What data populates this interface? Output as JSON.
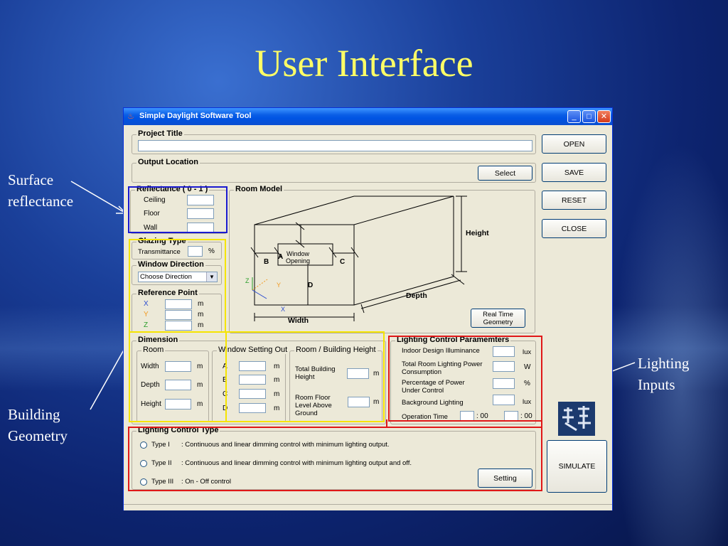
{
  "slide": {
    "title": "User Interface"
  },
  "annotations": {
    "surface": [
      "Surface",
      "reflectance"
    ],
    "building": [
      "Building",
      "Geometry"
    ],
    "lighting": [
      "Lighting",
      "Inputs"
    ]
  },
  "window": {
    "title": "Simple Daylight Software Tool",
    "icon": "app-icon"
  },
  "project": {
    "label": "Project Title",
    "value": ""
  },
  "output": {
    "label": "Output Location",
    "select_label": "Select"
  },
  "side_buttons": {
    "open": "OPEN",
    "save": "SAVE",
    "reset": "RESET",
    "close": "CLOSE",
    "simulate": "SIMULATE"
  },
  "reflectance": {
    "label": "Reflectance ( 0 - 1 )",
    "ceiling": "Ceiling",
    "floor": "Floor",
    "wall": "Wall"
  },
  "room_model": {
    "label": "Room Model",
    "a": "A",
    "b": "B",
    "c": "C",
    "d": "D",
    "window": [
      "Window",
      "Opening"
    ],
    "height": "Height",
    "depth": "Depth",
    "width": "Width",
    "axis_x": "X",
    "axis_y": "Y",
    "axis_z": "Z",
    "realtime": [
      "Real Time",
      "Geometry"
    ]
  },
  "glazing": {
    "label": "Glazing Type",
    "transmittance": "Transmittance",
    "unit": "%"
  },
  "window_direction": {
    "label": "Window Direction",
    "selected": "Choose Direction"
  },
  "reference_point": {
    "label": "Reference Point",
    "x": "X",
    "y": "Y",
    "z": "Z",
    "unit": "m"
  },
  "dimension": {
    "label": "Dimension",
    "room": {
      "label": "Room",
      "width": "Width",
      "depth": "Depth",
      "height": "Height",
      "unit": "m"
    },
    "window_setting": {
      "label": "Window Setting Out",
      "a": "A",
      "b": "B",
      "c": "C",
      "d": "D",
      "unit": "m"
    },
    "room_building": {
      "label": "Room / Building Height",
      "total": [
        "Total Building",
        "Height"
      ],
      "floor": [
        "Room Floor",
        "Level Above",
        "Ground"
      ],
      "unit": "m"
    }
  },
  "lighting_params": {
    "label": "Lighting Control Paramemters",
    "indoor": "Indoor Design Illuminance",
    "indoor_unit": "lux",
    "power": [
      "Total Room Lighting  Power",
      "Consumption"
    ],
    "power_unit": "W",
    "percent": [
      "Percentage of Power",
      "Under Control"
    ],
    "percent_unit": "%",
    "background": "Background Lighting",
    "background_unit": "lux",
    "operation": "Operation Time",
    "sep1": ": 00",
    "sep2": ": 00"
  },
  "lighting_type": {
    "label": "Lighting Control Type",
    "options": [
      {
        "id": "Type I",
        "text": ":  Continuous and linear dimming control with minimum lighting output."
      },
      {
        "id": "Type II",
        "text": ":  Continuous and linear dimming control with minimum lighting output and off."
      },
      {
        "id": "Type III",
        "text": ":  On - Off control"
      }
    ],
    "setting": "Setting"
  },
  "colors": {
    "slide_title": "#ffff66",
    "blue_box": "#1a1ad0",
    "yellow_box": "#f5e400",
    "red_box": "#e01818"
  }
}
